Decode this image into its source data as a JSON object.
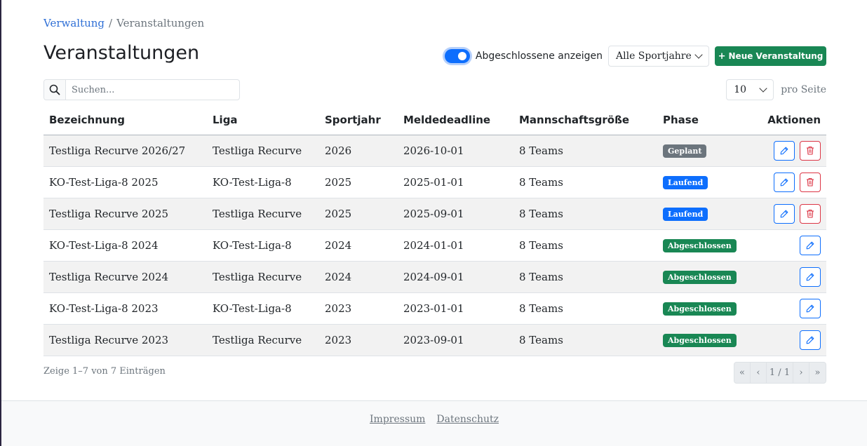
{
  "breadcrumb": {
    "parent": "Verwaltung",
    "separator": "/",
    "current": "Veranstaltungen"
  },
  "page_title": "Veranstaltungen",
  "toolbar": {
    "toggle_label": "Abgeschlossene anzeigen",
    "toggle_on": true,
    "year_select": "Alle Sportjahre",
    "new_button": "Neue Veranstaltung",
    "new_button_icon": "+"
  },
  "search": {
    "placeholder": "Suchen...",
    "value": ""
  },
  "per_page": {
    "value": "10",
    "label": "pro Seite"
  },
  "table": {
    "headers": [
      "Bezeichnung",
      "Liga",
      "Sportjahr",
      "Meldedeadline",
      "Mannschaftsgröße",
      "Phase",
      "Aktionen"
    ],
    "rows": [
      {
        "name": "Testliga Recurve 2026/27",
        "league": "Testliga Recurve",
        "year": "2026",
        "deadline": "2026-10-01",
        "size": "8 Teams",
        "phase": "Geplant",
        "deletable": true
      },
      {
        "name": "KO-Test-Liga-8 2025",
        "league": "KO-Test-Liga-8",
        "year": "2025",
        "deadline": "2025-01-01",
        "size": "8 Teams",
        "phase": "Laufend",
        "deletable": true
      },
      {
        "name": "Testliga Recurve 2025",
        "league": "Testliga Recurve",
        "year": "2025",
        "deadline": "2025-09-01",
        "size": "8 Teams",
        "phase": "Laufend",
        "deletable": true
      },
      {
        "name": "KO-Test-Liga-8 2024",
        "league": "KO-Test-Liga-8",
        "year": "2024",
        "deadline": "2024-01-01",
        "size": "8 Teams",
        "phase": "Abgeschlossen",
        "deletable": false
      },
      {
        "name": "Testliga Recurve 2024",
        "league": "Testliga Recurve",
        "year": "2024",
        "deadline": "2024-09-01",
        "size": "8 Teams",
        "phase": "Abgeschlossen",
        "deletable": false
      },
      {
        "name": "KO-Test-Liga-8 2023",
        "league": "KO-Test-Liga-8",
        "year": "2023",
        "deadline": "2023-01-01",
        "size": "8 Teams",
        "phase": "Abgeschlossen",
        "deletable": false
      },
      {
        "name": "Testliga Recurve 2023",
        "league": "Testliga Recurve",
        "year": "2023",
        "deadline": "2023-09-01",
        "size": "8 Teams",
        "phase": "Abgeschlossen",
        "deletable": false
      }
    ]
  },
  "pagination": {
    "info": "Zeige 1–7 von 7 Einträgen",
    "first": "«",
    "prev": "‹",
    "page": "1 / 1",
    "next": "›",
    "last": "»"
  },
  "footer": {
    "impressum": "Impressum",
    "datenschutz": "Datenschutz"
  },
  "colors": {
    "primary": "#0d6efd",
    "success": "#198754",
    "danger": "#dc3545",
    "secondary": "#6c757d"
  }
}
